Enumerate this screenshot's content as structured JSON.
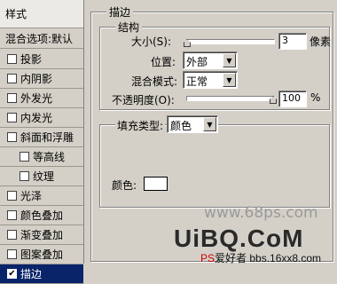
{
  "left_panel": {
    "title": "样式",
    "blend_options": "混合选项:默认",
    "items": [
      {
        "label": "投影",
        "checked": false,
        "sub": false
      },
      {
        "label": "内阴影",
        "checked": false,
        "sub": false
      },
      {
        "label": "外发光",
        "checked": false,
        "sub": false
      },
      {
        "label": "内发光",
        "checked": false,
        "sub": false
      },
      {
        "label": "斜面和浮雕",
        "checked": false,
        "sub": false
      },
      {
        "label": "等高线",
        "checked": false,
        "sub": true
      },
      {
        "label": "纹理",
        "checked": false,
        "sub": true
      },
      {
        "label": "光泽",
        "checked": false,
        "sub": false
      },
      {
        "label": "颜色叠加",
        "checked": false,
        "sub": false
      },
      {
        "label": "渐变叠加",
        "checked": false,
        "sub": false
      },
      {
        "label": "图案叠加",
        "checked": false,
        "sub": false
      },
      {
        "label": "描边",
        "checked": true,
        "sub": false,
        "selected": true
      }
    ],
    "check_glyph": "✔"
  },
  "stroke": {
    "group_title": "描边",
    "structure_title": "结构",
    "size_label": "大小(S):",
    "size_value": "3",
    "size_unit": "像素",
    "position_label": "位置:",
    "position_value": "外部",
    "blend_label": "混合模式:",
    "blend_value": "正常",
    "opacity_label": "不透明度(O):",
    "opacity_value": "100",
    "opacity_unit": "%",
    "size_slider_fraction": 0.01,
    "opacity_slider_fraction": 1.0
  },
  "fill": {
    "type_label": "填充类型:",
    "type_value": "颜色",
    "color_label": "颜色:",
    "color_hex": "#ffffff"
  },
  "watermark": {
    "site": "www.68ps.com",
    "brand": "UiBQ.CoM",
    "footer_red": "PS",
    "footer_text": "爱好者 bbs.16xx8.com"
  },
  "icons": {
    "dropdown": "chevron-down-icon",
    "checkbox_check": "check-icon"
  }
}
